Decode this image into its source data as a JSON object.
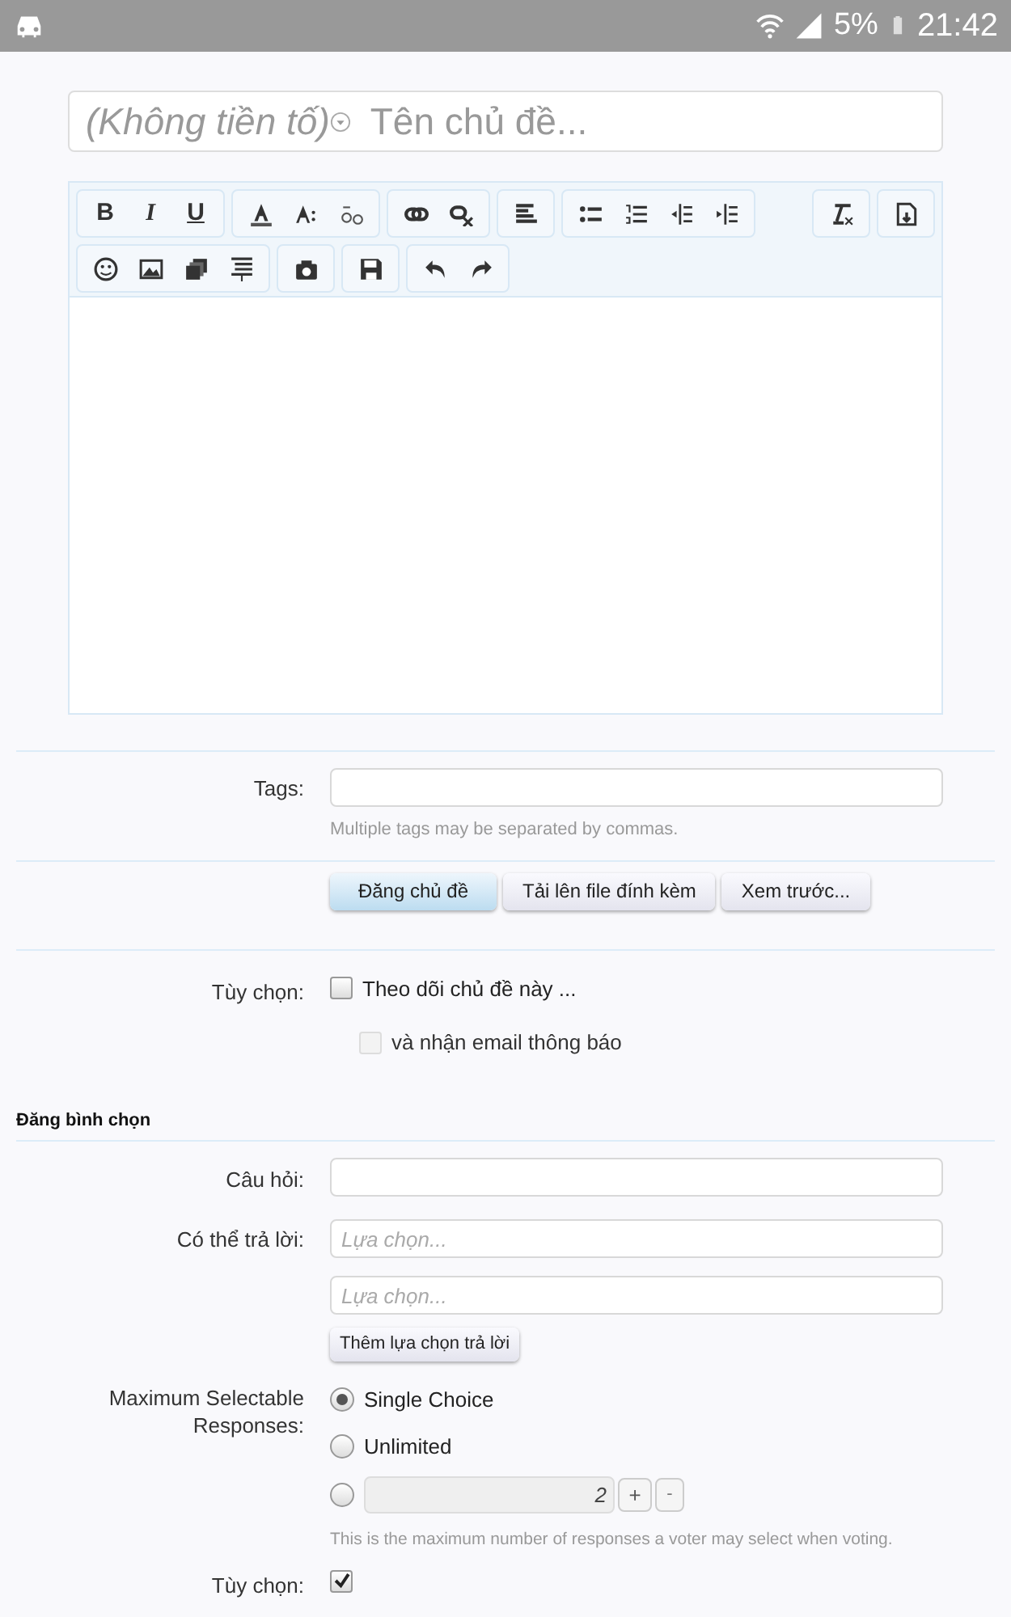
{
  "status_bar": {
    "battery": "5%",
    "time": "21:42"
  },
  "title_field": {
    "prefix": "(Không tiền tố)",
    "placeholder": "Tên chủ đề..."
  },
  "editor": {
    "format_labels": [
      "B",
      "I",
      "U"
    ]
  },
  "tags": {
    "label": "Tags:",
    "hint": "Multiple tags may be separated by commas."
  },
  "buttons": [
    {
      "label": "Đăng chủ đề",
      "primary": true
    },
    {
      "label": "Tải lên file đính kèm",
      "primary": false
    },
    {
      "label": "Xem trước...",
      "primary": false
    }
  ],
  "options": {
    "label": "Tùy chọn:",
    "items": [
      {
        "label": "Theo dõi chủ đề này ...",
        "checked": false,
        "disabled": false
      },
      {
        "label": "và nhận email thông báo",
        "checked": false,
        "disabled": true
      }
    ]
  },
  "poll": {
    "heading": "Đăng bình chọn",
    "question_label": "Câu hỏi:",
    "answers_label": "Có thể trả lời:",
    "answers": [
      {
        "placeholder": "Lựa chọn..."
      },
      {
        "placeholder": "Lựa chọn..."
      }
    ],
    "add_button": "Thêm lựa chọn trả lời",
    "max_label": "Maximum Selectable Responses:",
    "max_choices": [
      {
        "kind": "label",
        "label": "Single Choice",
        "selected": true
      },
      {
        "kind": "label",
        "label": "Unlimited",
        "selected": false
      },
      {
        "kind": "number",
        "value": "2",
        "plus": "+",
        "minus": "-",
        "selected": false
      }
    ],
    "max_hint": "This is the maximum number of responses a voter may select when voting.",
    "options_label": "Tùy chọn:",
    "options_checked": true
  }
}
